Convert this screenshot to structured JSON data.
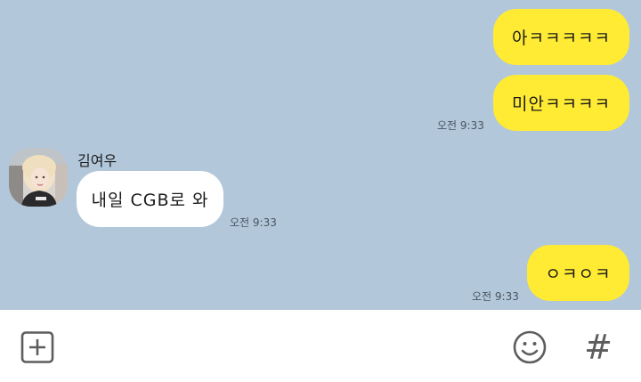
{
  "chat": {
    "messages": [
      {
        "sender": "me",
        "text": "아ㅋㅋㅋㅋㅋ"
      },
      {
        "sender": "me",
        "text": "미안ㅋㅋㅋㅋ",
        "time": "오전 9:33"
      },
      {
        "sender": "김여우",
        "text": "내일 CGB로 와",
        "time": "오전 9:33"
      },
      {
        "sender": "me",
        "text": "ㅇㅋㅇㅋ",
        "time": "오전 9:33"
      }
    ]
  },
  "input_bar": {
    "icons": [
      "plus-box-icon",
      "emoji-icon",
      "hashtag-icon"
    ],
    "hashtag_glyph": "#"
  },
  "colors": {
    "chat_background": "#b2c7da",
    "my_bubble": "#ffeb33",
    "their_bubble": "#ffffff",
    "input_background": "#ffffff"
  }
}
